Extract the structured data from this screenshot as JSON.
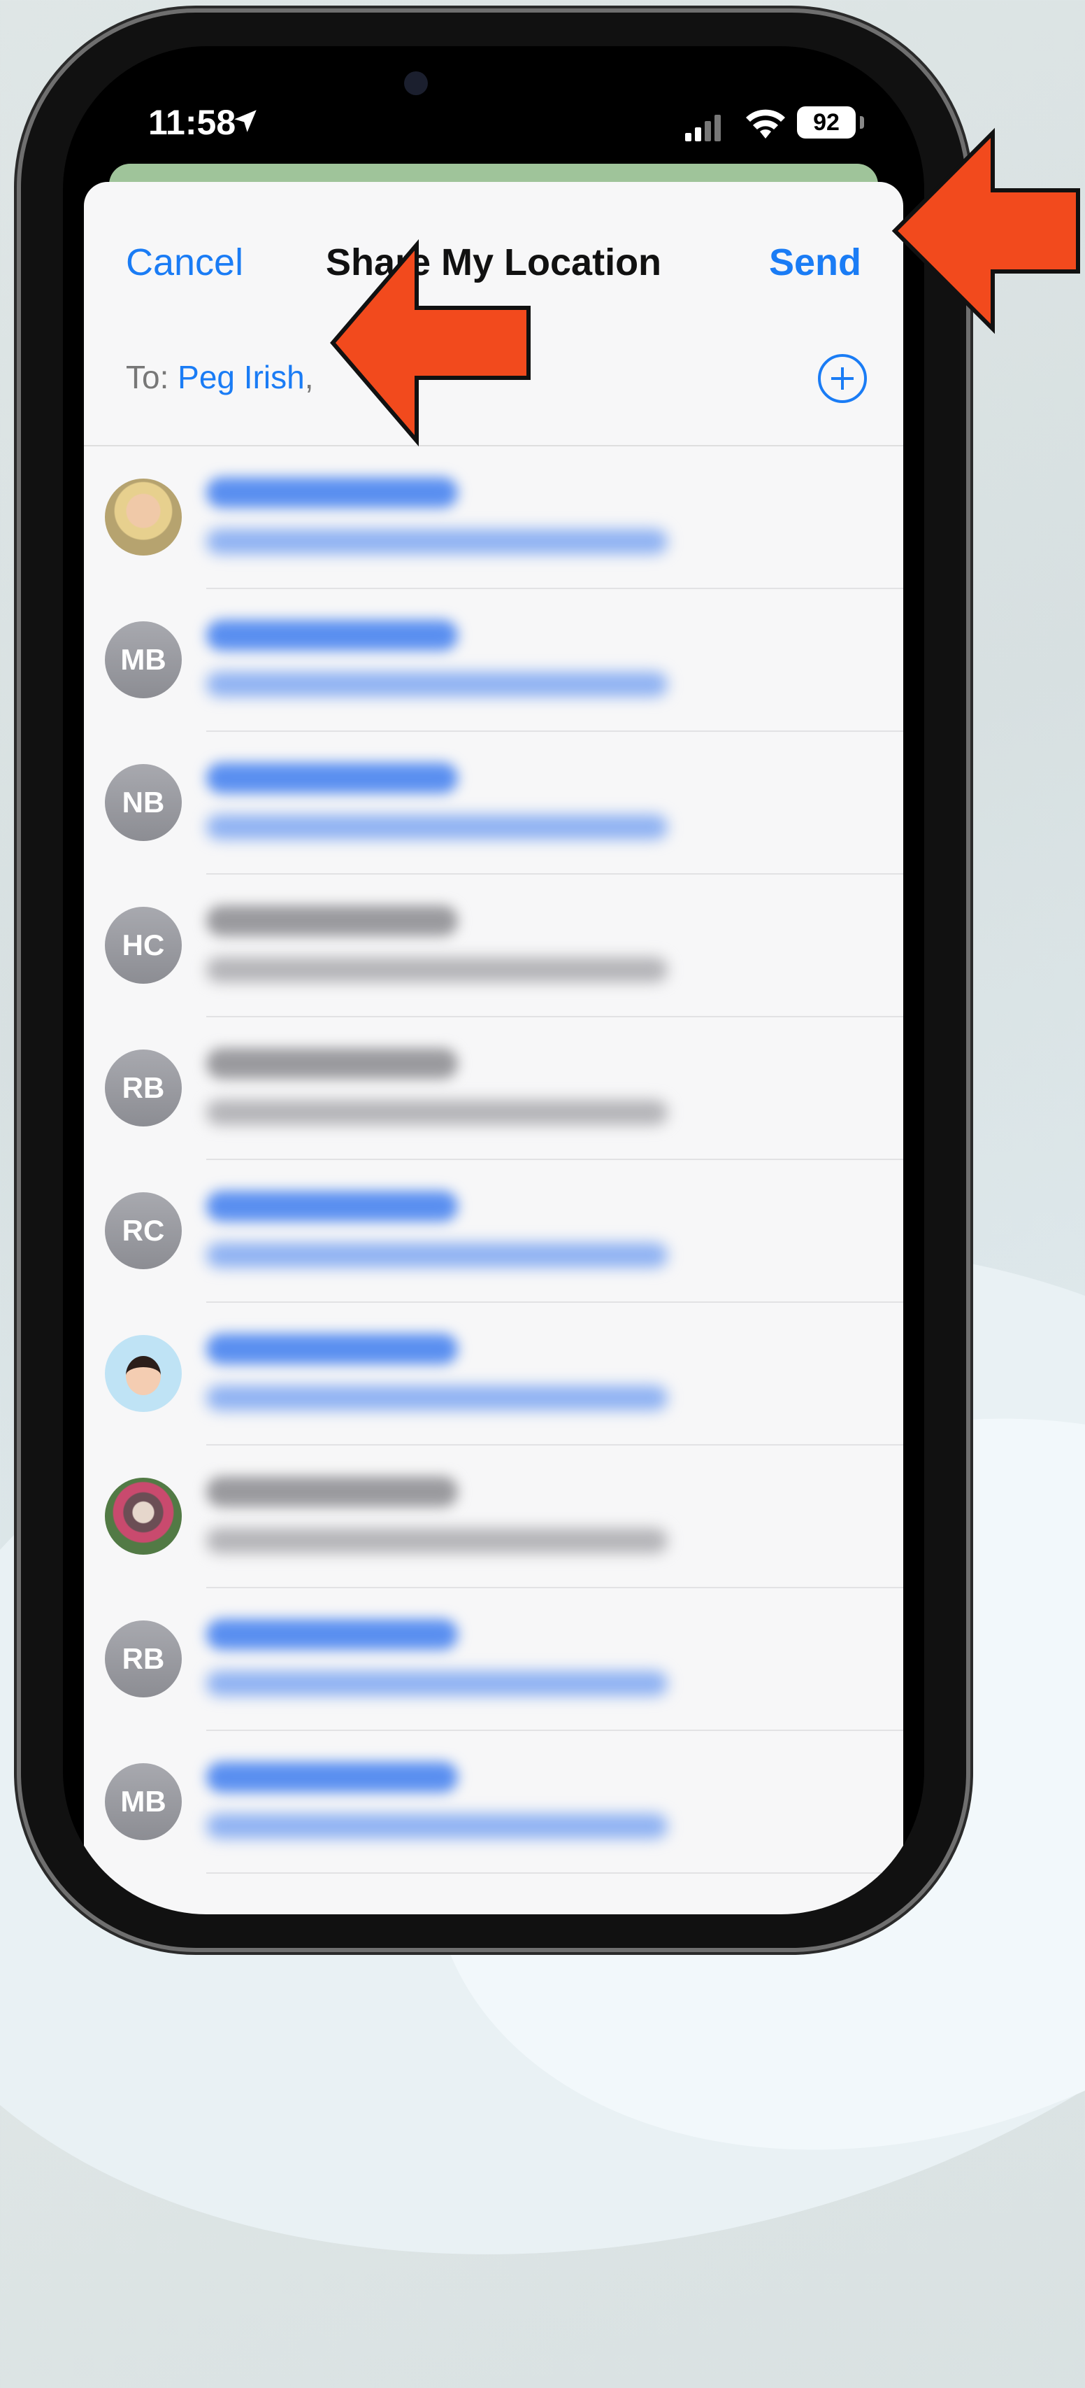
{
  "status_bar": {
    "time": "11:58",
    "battery": "92"
  },
  "header": {
    "cancel_label": "Cancel",
    "title": "Share My Location",
    "send_label": "Send"
  },
  "to_field": {
    "prefix": "To:",
    "recipient": "Peg Irish",
    "separator": ","
  },
  "contacts": [
    {
      "avatar": "photo",
      "initials": "",
      "style": "blue"
    },
    {
      "avatar": "initials",
      "initials": "MB",
      "style": "blue"
    },
    {
      "avatar": "initials",
      "initials": "NB",
      "style": "blue"
    },
    {
      "avatar": "initials",
      "initials": "HC",
      "style": "gray"
    },
    {
      "avatar": "initials",
      "initials": "RB",
      "style": "gray"
    },
    {
      "avatar": "initials",
      "initials": "RC",
      "style": "blue"
    },
    {
      "avatar": "memoji",
      "initials": "",
      "style": "blue"
    },
    {
      "avatar": "photo",
      "initials": "",
      "style": "gray"
    },
    {
      "avatar": "initials",
      "initials": "RB",
      "style": "blue"
    },
    {
      "avatar": "initials",
      "initials": "MB",
      "style": "blue"
    }
  ],
  "colors": {
    "accent": "#1a7cf5",
    "annotation_arrow": "#f24a1d"
  },
  "icons": [
    "location-arrow-icon",
    "signal-icon",
    "wifi-icon",
    "battery-icon",
    "add-contact-icon"
  ]
}
